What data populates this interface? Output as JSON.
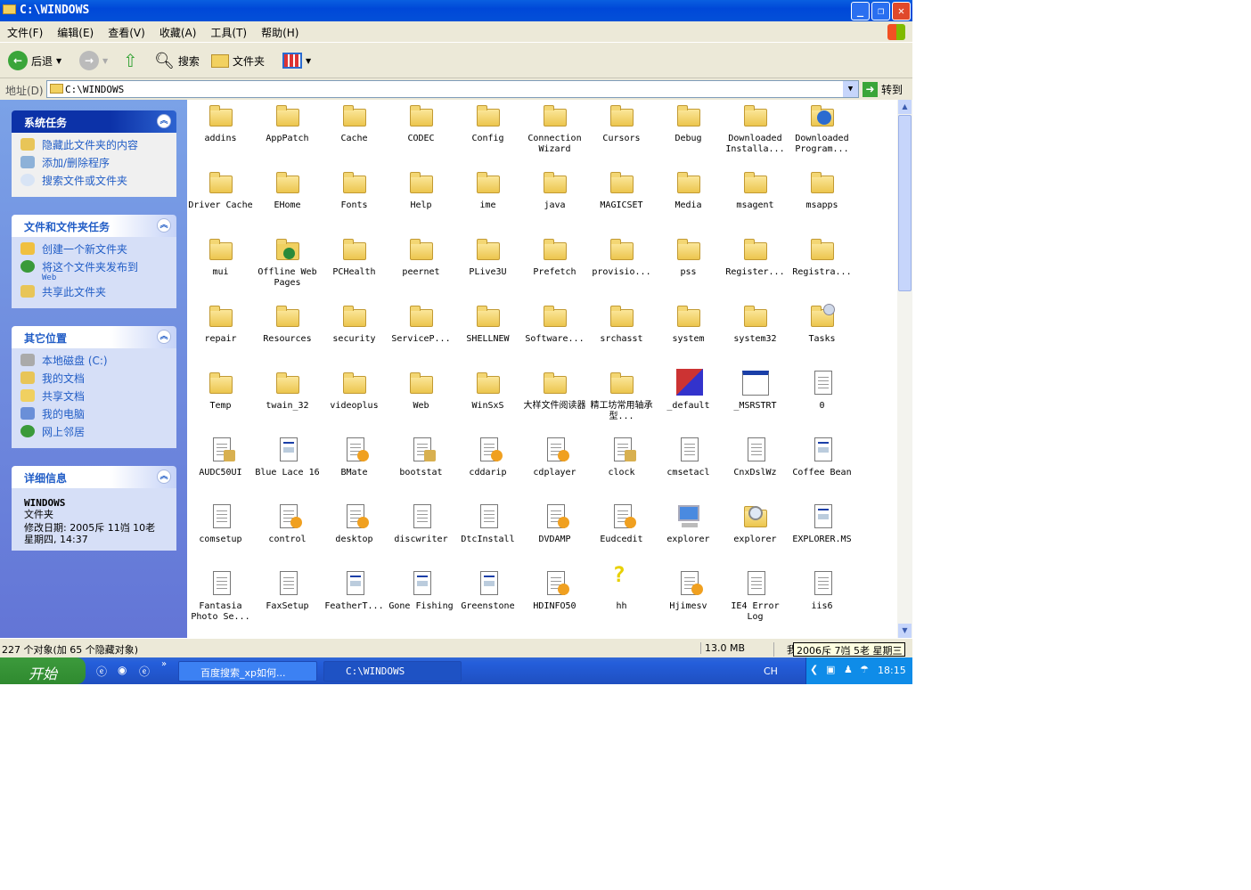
{
  "window": {
    "title": "C:\\WINDOWS"
  },
  "menu": [
    "文件(F)",
    "编辑(E)",
    "查看(V)",
    "收藏(A)",
    "工具(T)",
    "帮助(H)"
  ],
  "toolbar": {
    "back": "后退",
    "search": "搜索",
    "folders": "文件夹"
  },
  "address": {
    "label": "地址(D)",
    "value": "C:\\WINDOWS",
    "go": "转到"
  },
  "panels": {
    "system": {
      "title": "系统任务",
      "items": [
        "隐藏此文件夹的内容",
        "添加/删除程序",
        "搜索文件或文件夹"
      ]
    },
    "file": {
      "title": "文件和文件夹任务",
      "items": [
        "创建一个新文件夹",
        "将这个文件夹发布到",
        "共享此文件夹"
      ],
      "web": "Web"
    },
    "other": {
      "title": "其它位置",
      "items": [
        "本地磁盘 (C:)",
        "我的文档",
        "共享文档",
        "我的电脑",
        "网上邻居"
      ]
    },
    "details": {
      "title": "详细信息",
      "name": "WINDOWS",
      "type": "文件夹",
      "modified": "修改日期: 2005斥 11岿 10老 星期四, 14:37"
    }
  },
  "items": [
    [
      "addins",
      "folder"
    ],
    [
      "AppPatch",
      "folder"
    ],
    [
      "Cache",
      "folder"
    ],
    [
      "CODEC",
      "folder"
    ],
    [
      "Config",
      "folder"
    ],
    [
      "Connection Wizard",
      "folder"
    ],
    [
      "Cursors",
      "folder"
    ],
    [
      "Debug",
      "folder"
    ],
    [
      "Downloaded Installa...",
      "folder"
    ],
    [
      "Downloaded Program...",
      "iefolder"
    ],
    [
      "Driver Cache",
      "folder"
    ],
    [
      "EHome",
      "folder"
    ],
    [
      "Fonts",
      "folder"
    ],
    [
      "Help",
      "folder"
    ],
    [
      "ime",
      "folder"
    ],
    [
      "java",
      "folder"
    ],
    [
      "MAGICSET",
      "folder"
    ],
    [
      "Media",
      "folder"
    ],
    [
      "msagent",
      "folder"
    ],
    [
      "msapps",
      "folder"
    ],
    [
      "mui",
      "folder"
    ],
    [
      "Offline Web Pages",
      "offline"
    ],
    [
      "PCHealth",
      "folder"
    ],
    [
      "peernet",
      "folder"
    ],
    [
      "PLive3U",
      "folder"
    ],
    [
      "Prefetch",
      "folder"
    ],
    [
      "provisio...",
      "folder"
    ],
    [
      "pss",
      "folder"
    ],
    [
      "Register...",
      "folder"
    ],
    [
      "Registra...",
      "folder"
    ],
    [
      "repair",
      "folder"
    ],
    [
      "Resources",
      "folder"
    ],
    [
      "security",
      "folder"
    ],
    [
      "ServiceP...",
      "folder"
    ],
    [
      "SHELLNEW",
      "folder"
    ],
    [
      "Software...",
      "folder"
    ],
    [
      "srchasst",
      "folder"
    ],
    [
      "system",
      "folder"
    ],
    [
      "system32",
      "folder"
    ],
    [
      "Tasks",
      "tasks"
    ],
    [
      "Temp",
      "folder"
    ],
    [
      "twain_32",
      "folder"
    ],
    [
      "videoplus",
      "folder"
    ],
    [
      "Web",
      "folder"
    ],
    [
      "WinSxS",
      "folder"
    ],
    [
      "大样文件阅读器",
      "folder"
    ],
    [
      "精工坊常用轴承型...",
      "folder"
    ],
    [
      "_default",
      "msdos"
    ],
    [
      "_MSRSTRT",
      "window"
    ],
    [
      "0",
      "text"
    ],
    [
      "AUDC50UI",
      "edit"
    ],
    [
      "Blue Lace 16",
      "image"
    ],
    [
      "BMate",
      "gear"
    ],
    [
      "bootstat",
      "edit"
    ],
    [
      "cddarip",
      "gear"
    ],
    [
      "cdplayer",
      "gear"
    ],
    [
      "clock",
      "edit"
    ],
    [
      "cmsetacl",
      "text"
    ],
    [
      "CnxDslWz",
      "text"
    ],
    [
      "Coffee Bean",
      "image"
    ],
    [
      "comsetup",
      "text"
    ],
    [
      "control",
      "gear"
    ],
    [
      "desktop",
      "gear"
    ],
    [
      "discwriter",
      "text"
    ],
    [
      "DtcInstall",
      "text"
    ],
    [
      "DVDAMP",
      "gear"
    ],
    [
      "Eudcedit",
      "gear"
    ],
    [
      "explorer",
      "computer"
    ],
    [
      "explorer",
      "magnifier"
    ],
    [
      "EXPLORER.MS",
      "image"
    ],
    [
      "Fantasia Photo Se...",
      "text"
    ],
    [
      "FaxSetup",
      "text"
    ],
    [
      "FeatherT...",
      "image"
    ],
    [
      "Gone Fishing",
      "image"
    ],
    [
      "Greenstone",
      "image"
    ],
    [
      "HDINFO50",
      "gear"
    ],
    [
      "hh",
      "help"
    ],
    [
      "Hjimesv",
      "gear"
    ],
    [
      "IE4 Error Log",
      "text"
    ],
    [
      "iis6",
      "text"
    ]
  ],
  "status": {
    "count": "227 个对象(加 65 个隐藏对象)",
    "size": "13.0 MB",
    "zone": "我"
  },
  "tooltip": "2006斥 7岿 5老 星期三",
  "taskbar": {
    "start": "开始",
    "tasks": [
      "百度搜索_xp如何...",
      "C:\\WINDOWS"
    ],
    "lang": "CH",
    "time": "18:15"
  }
}
